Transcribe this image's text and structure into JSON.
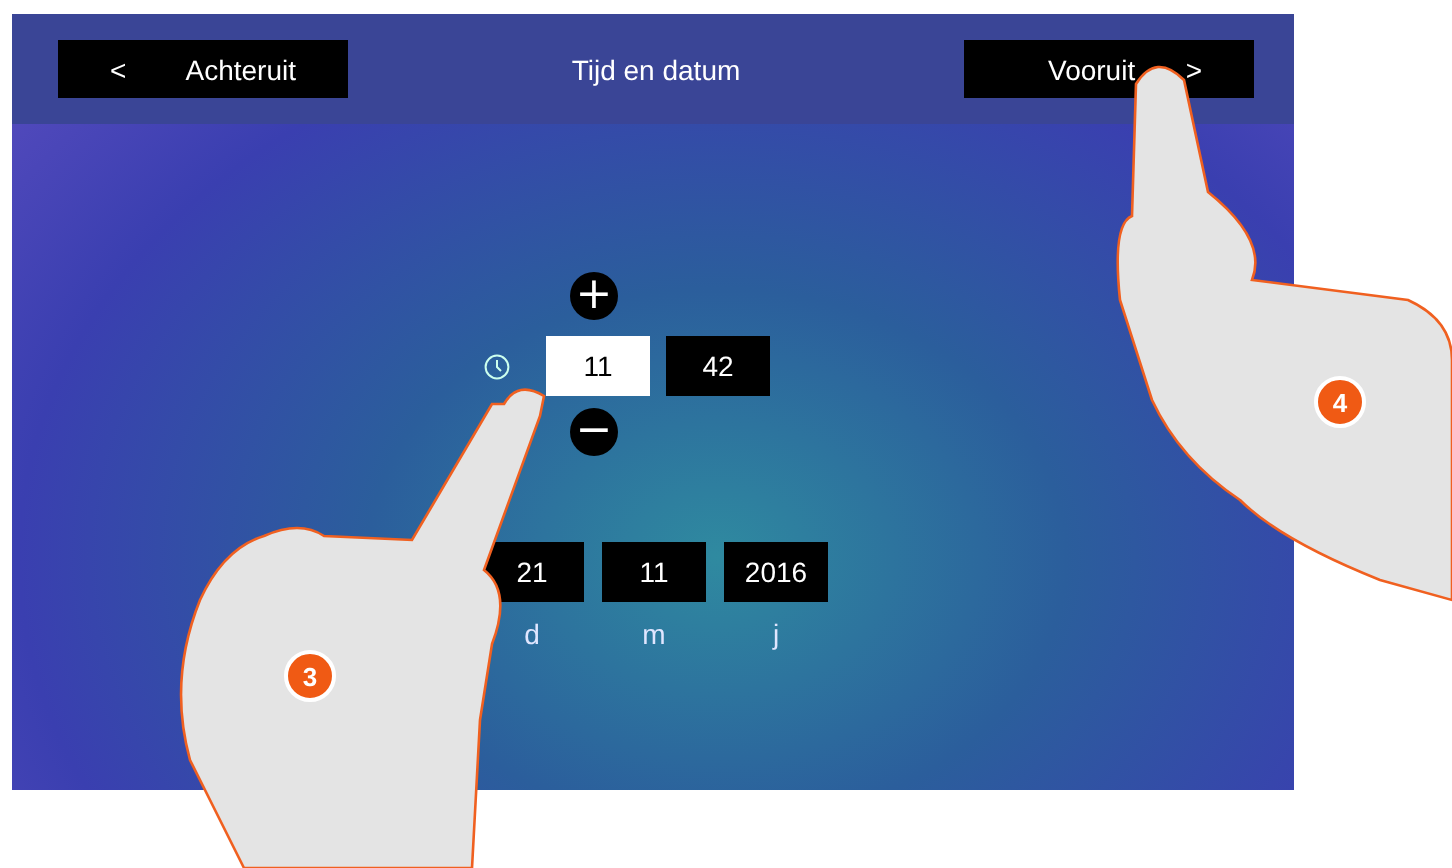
{
  "header": {
    "back_button": {
      "arrow": "<",
      "label": "Achteruit"
    },
    "title": "Tijd en datum",
    "forward_button": {
      "label": "Vooruit",
      "arrow": ">"
    }
  },
  "time": {
    "increase": "+",
    "decrease": "−",
    "fields": [
      {
        "value": "11",
        "selected": true
      },
      {
        "value": "42",
        "selected": false
      }
    ]
  },
  "date": {
    "fields": [
      {
        "value": "21",
        "label": "d"
      },
      {
        "value": "11",
        "label": "m"
      },
      {
        "value": "2016",
        "label": "j"
      }
    ]
  },
  "callouts": [
    {
      "number": "3"
    },
    {
      "number": "4"
    }
  ]
}
